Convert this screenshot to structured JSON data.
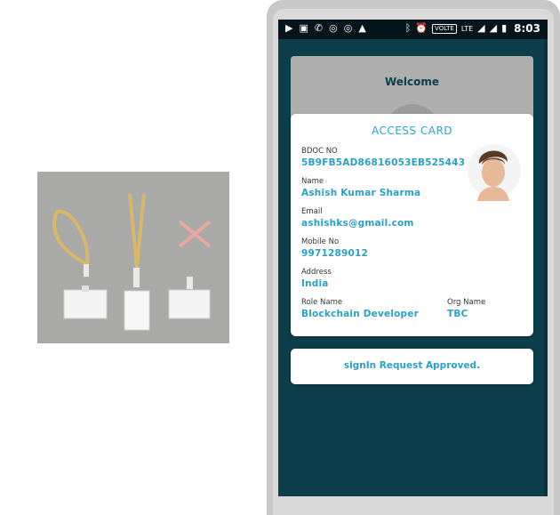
{
  "status_bar": {
    "left_icons": [
      "youtube-icon",
      "image-icon",
      "phone-wifi-icon",
      "chrome-icon",
      "chrome-icon",
      "warning-icon"
    ],
    "right_icons": [
      "bluetooth-icon",
      "alarm-icon",
      "volte-icon",
      "lte-icon",
      "signal-icon",
      "signal-icon",
      "battery-icon"
    ],
    "volte_label": "VOLTE",
    "lte_label": "LTE",
    "time": "8:03"
  },
  "welcome": {
    "title": "Welcome"
  },
  "access_card": {
    "title": "ACCESS CARD",
    "fields": [
      {
        "label": "BDOC NO",
        "value": "5B9FB5AD86816053EB525443"
      },
      {
        "label": "Name",
        "value": "Ashish Kumar Sharma"
      },
      {
        "label": "Email",
        "value": "ashishks@gmail.com"
      },
      {
        "label": "Mobile No",
        "value": "9971289012"
      },
      {
        "label": "Address",
        "value": "India"
      },
      {
        "label": "Role Name",
        "value": "Blockchain Developer"
      },
      {
        "label": "Org Name",
        "value": "TBC"
      }
    ]
  },
  "approval": {
    "message": "signIn Request Approved."
  },
  "colors": {
    "screen_bg": "#0d3e4c",
    "accent": "#2aa0c4",
    "status_bar": "#06151b",
    "illustration_bg": "#a9a9a7"
  }
}
